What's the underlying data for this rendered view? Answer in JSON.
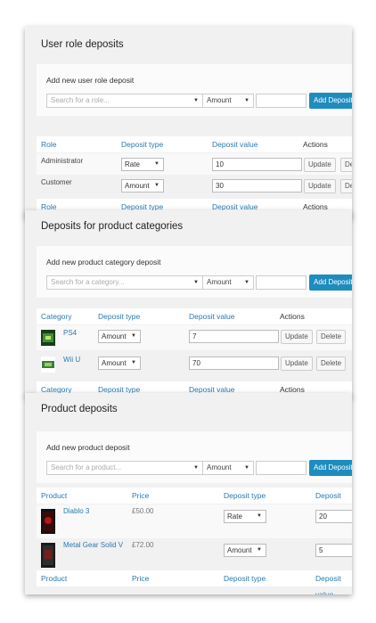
{
  "panels": [
    {
      "title": "User role deposits",
      "add_label": "Add new user role deposit",
      "search_placeholder": "Search for a role...",
      "amount_select": "Amount",
      "add_button": "Add Deposit",
      "headers": [
        "Role",
        "Deposit type",
        "Deposit value",
        "Actions"
      ],
      "rows": [
        {
          "name": "Administrator",
          "type": "Rate",
          "value": "10",
          "update": "Update",
          "delete": "Delete"
        },
        {
          "name": "Customer",
          "type": "Amount",
          "value": "30",
          "update": "Update",
          "delete": "Delete"
        }
      ]
    },
    {
      "title": "Deposits for product categories",
      "add_label": "Add new product category deposit",
      "search_placeholder": "Search for a category...",
      "amount_select": "Amount",
      "add_button": "Add Deposit",
      "headers": [
        "Category",
        "Deposit type",
        "Deposit value",
        "Actions"
      ],
      "rows": [
        {
          "name": "PS4",
          "type": "Amount",
          "value": "7",
          "update": "Update",
          "delete": "Delete"
        },
        {
          "name": "Wii U",
          "type": "Amount",
          "value": "70",
          "update": "Update",
          "delete": "Delete"
        }
      ]
    },
    {
      "title": "Product deposits",
      "add_label": "Add new product deposit",
      "search_placeholder": "Search for a product...",
      "amount_select": "Amount",
      "add_button": "Add Deposit",
      "headers": [
        "Product",
        "Price",
        "Deposit type",
        "Deposit value"
      ],
      "rows": [
        {
          "name": "Diablo 3",
          "price": "£50.00",
          "type": "Rate",
          "value": "20"
        },
        {
          "name": "Metal Gear Solid V",
          "price": "£72.00",
          "type": "Amount",
          "value": "5"
        }
      ]
    }
  ],
  "colors": {
    "accent": "#1e8cbe",
    "link": "#2a7ab0"
  }
}
